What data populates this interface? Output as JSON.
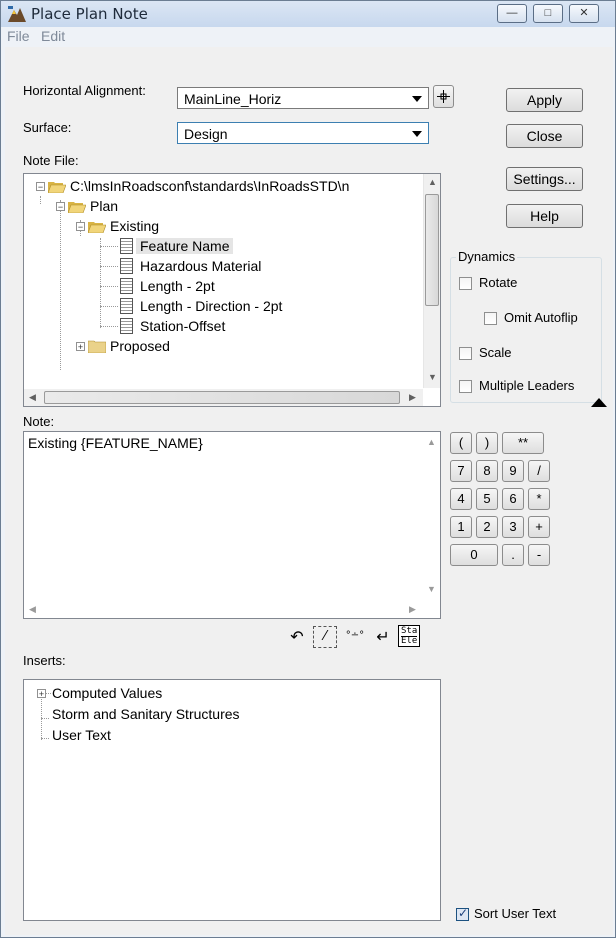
{
  "window": {
    "title": "Place Plan Note",
    "controls": {
      "minimize": "—",
      "maximize": "□",
      "close": "✕"
    }
  },
  "menu": {
    "items": [
      "File",
      "Edit"
    ]
  },
  "form": {
    "horizontal_alignment_label": "Horizontal Alignment:",
    "horizontal_alignment_value": "MainLine_Horiz",
    "surface_label": "Surface:",
    "surface_value": "Design",
    "note_file_label": "Note File:"
  },
  "buttons": {
    "apply": "Apply",
    "close": "Close",
    "settings": "Settings...",
    "help": "Help",
    "target_icon": "target-icon"
  },
  "note_tree": {
    "root": "C:\\lmsInRoadsconf\\standards\\InRoadsSTD\\n",
    "plan": "Plan",
    "existing": "Existing",
    "items": [
      "Feature Name",
      "Hazardous Material",
      "Length - 2pt",
      "Length - Direction - 2pt",
      "Station-Offset"
    ],
    "proposed": "Proposed",
    "selected_item": "Feature Name"
  },
  "dynamics": {
    "title": "Dynamics",
    "rotate": {
      "label": "Rotate",
      "checked": false
    },
    "omit_autoflip": {
      "label": "Omit Autoflip",
      "checked": false
    },
    "scale": {
      "label": "Scale",
      "checked": false
    },
    "multiple_leaders": {
      "label": "Multiple Leaders",
      "checked": false
    }
  },
  "note": {
    "label": "Note:",
    "text": "Existing {FEATURE_NAME}"
  },
  "keypad": {
    "row1": [
      "(",
      ")",
      "**"
    ],
    "row2": [
      "7",
      "8",
      "9",
      "/"
    ],
    "row3": [
      "4",
      "5",
      "6",
      "*"
    ],
    "row4": [
      "1",
      "2",
      "3",
      "+"
    ],
    "row5": [
      "0",
      ".",
      "-"
    ]
  },
  "toolbar_icons": [
    "undo-icon",
    "clear-icon",
    "symbol-icon",
    "newline-icon",
    "sta-ele-icon"
  ],
  "sta_ele_text": {
    "top": "Sta",
    "bottom": "Ele"
  },
  "inserts": {
    "label": "Inserts:",
    "items": [
      "Computed Values",
      "Storm and Sanitary Structures",
      "User Text"
    ]
  },
  "sort_user_text": {
    "label": "Sort User Text",
    "checked": true
  },
  "colors": {
    "selection": "#e5e5e5",
    "title_bar": "#c7d8ee",
    "panel_bg": "#f0f0f0"
  }
}
